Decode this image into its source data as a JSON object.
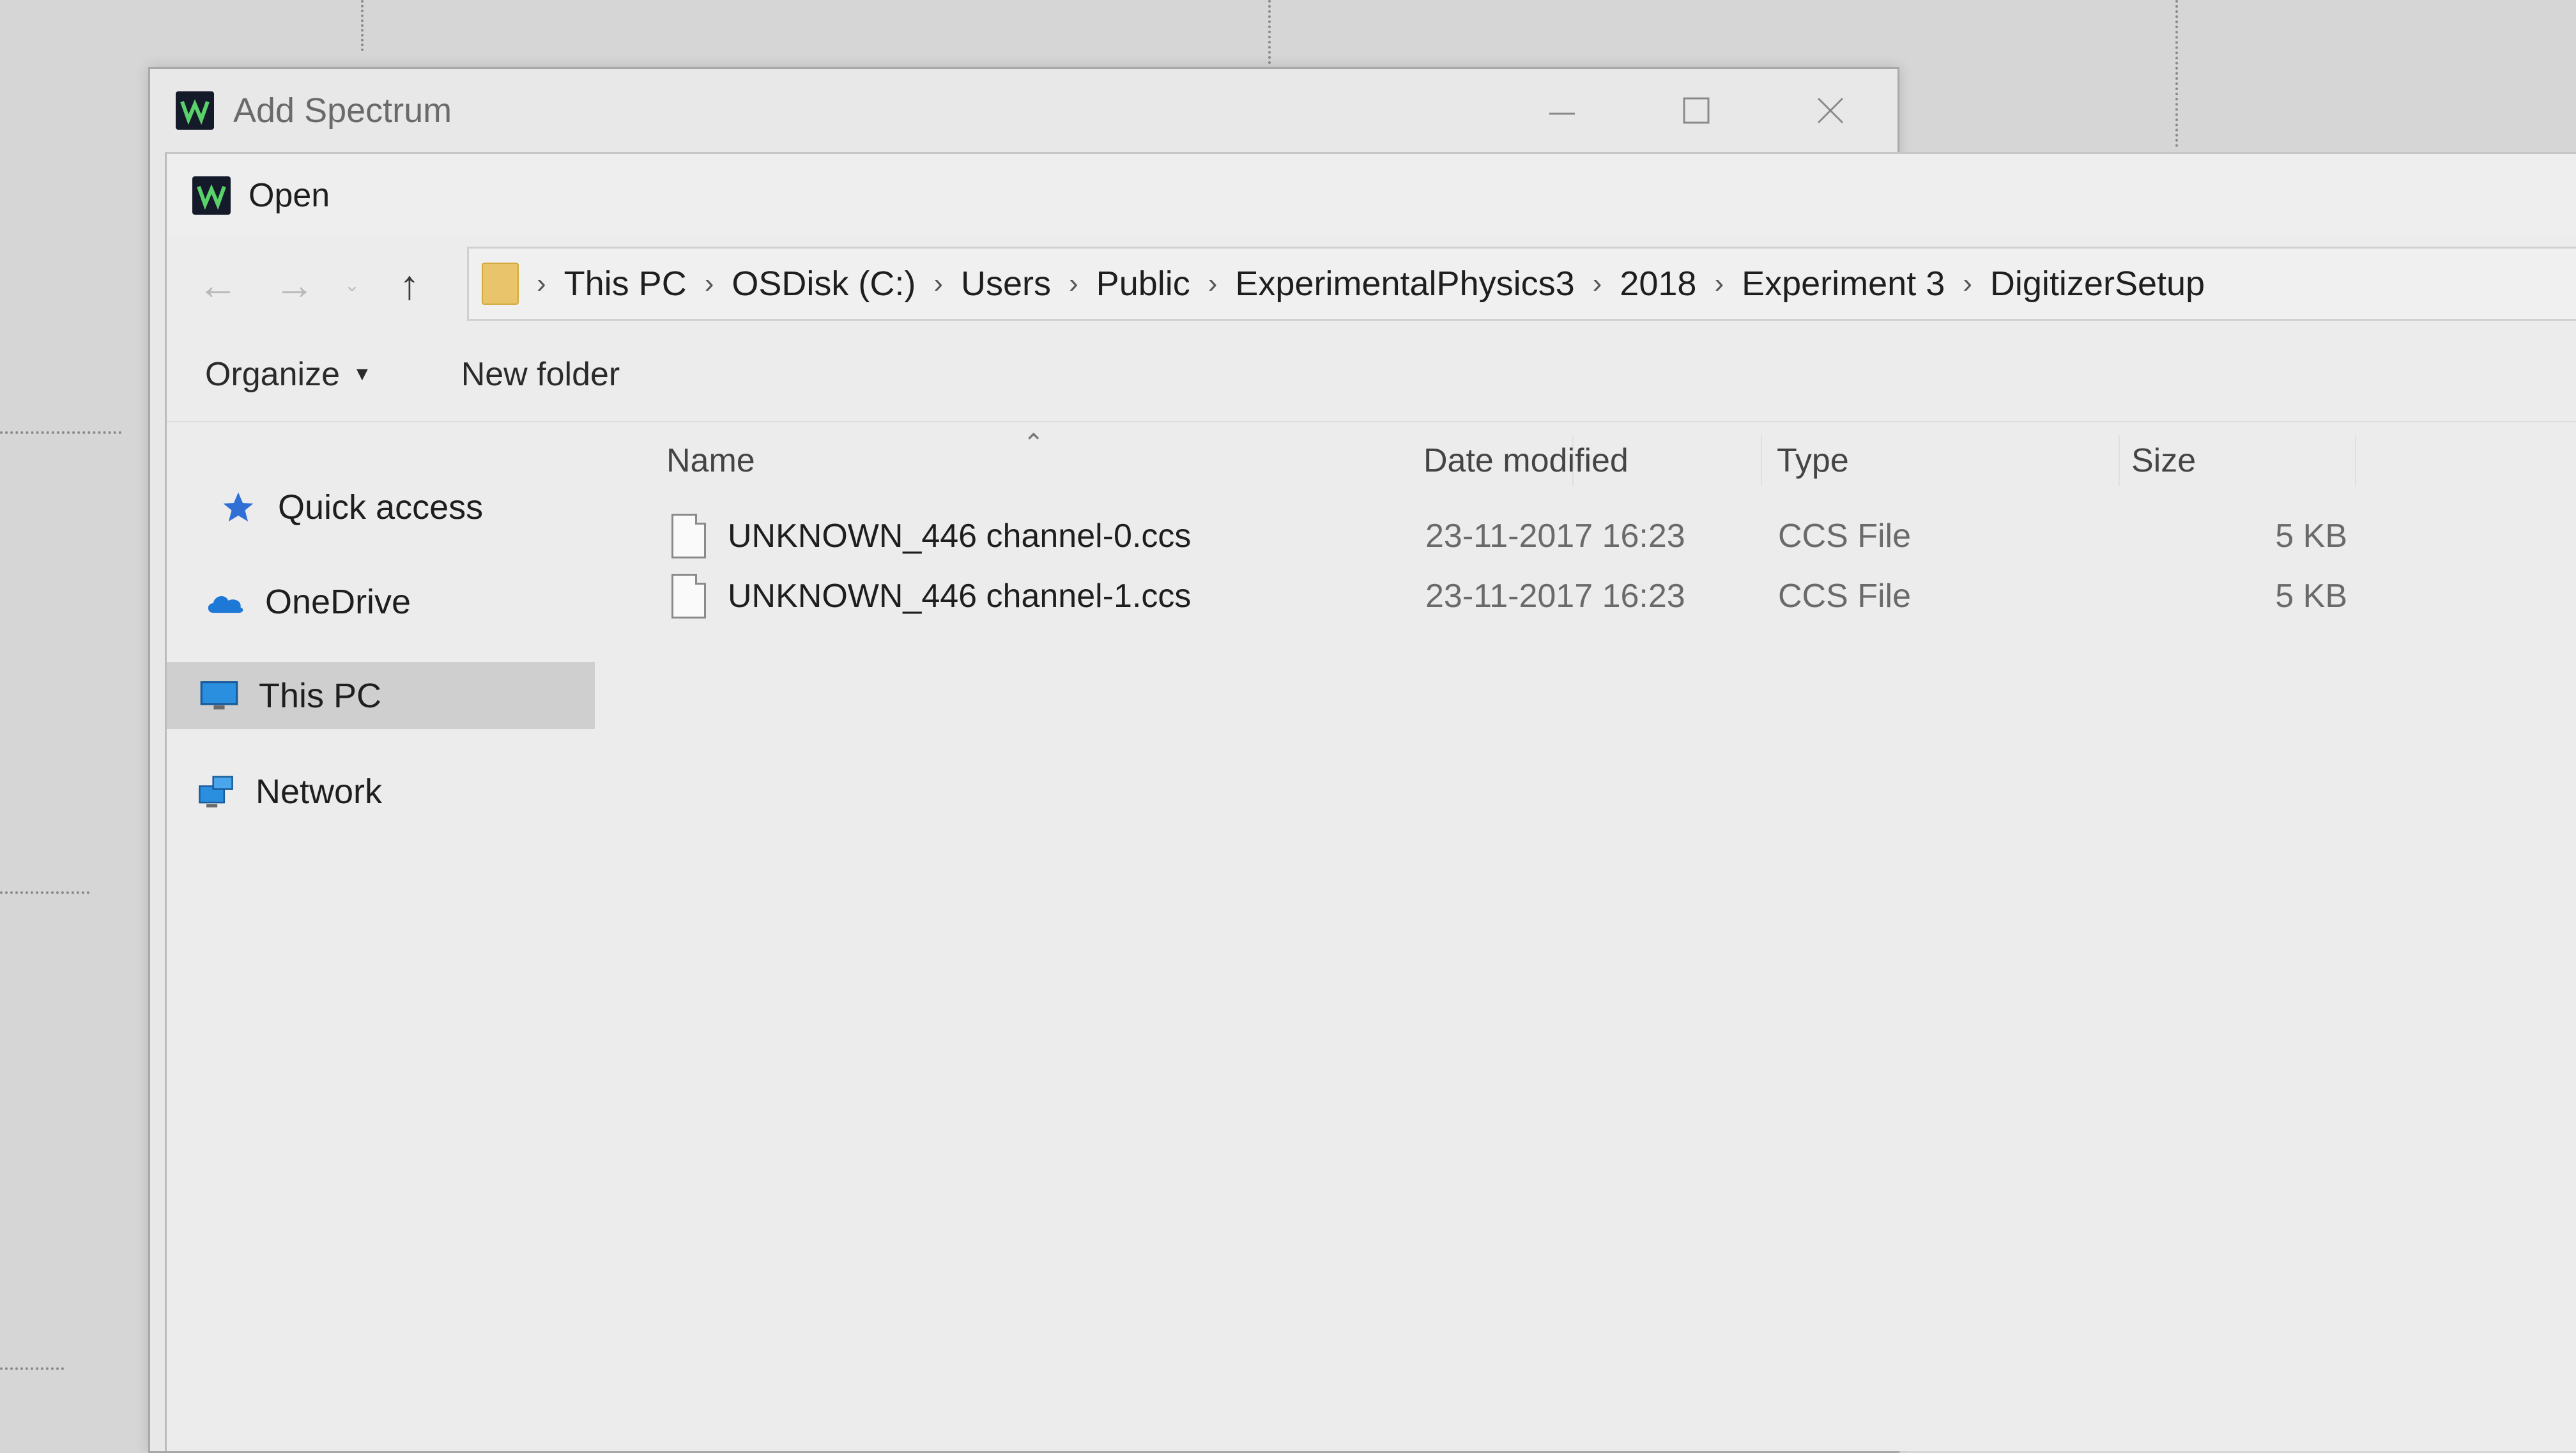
{
  "back_window": {
    "title": "Add Spectrum"
  },
  "dialog": {
    "title": "Open"
  },
  "navigation": {
    "back_icon": "arrow-left-icon",
    "forward_icon": "arrow-right-icon",
    "up_icon": "arrow-up-icon"
  },
  "breadcrumb": [
    "This PC",
    "OSDisk (C:)",
    "Users",
    "Public",
    "ExperimentalPhysics3",
    "2018",
    "Experiment 3",
    "DigitizerSetup"
  ],
  "toolbar": {
    "organize_label": "Organize",
    "new_folder_label": "New folder"
  },
  "nav_pane": [
    {
      "label": "Quick access",
      "icon": "star-icon"
    },
    {
      "label": "OneDrive",
      "icon": "cloud-icon"
    },
    {
      "label": "This PC",
      "icon": "monitor-icon",
      "selected": true
    },
    {
      "label": "Network",
      "icon": "network-icon"
    }
  ],
  "columns": {
    "name": "Name",
    "date": "Date modified",
    "type": "Type",
    "size": "Size"
  },
  "files": [
    {
      "name": "UNKNOWN_446 channel-0.ccs",
      "date": "23-11-2017 16:23",
      "type": "CCS File",
      "size": "5 KB"
    },
    {
      "name": "UNKNOWN_446 channel-1.ccs",
      "date": "23-11-2017 16:23",
      "type": "CCS File",
      "size": "5 KB"
    }
  ],
  "colors": {
    "selected_bg": "#cfcfcf",
    "folder": "#e9c46a",
    "star": "#2f6fd6",
    "cloud": "#1e78d6"
  }
}
